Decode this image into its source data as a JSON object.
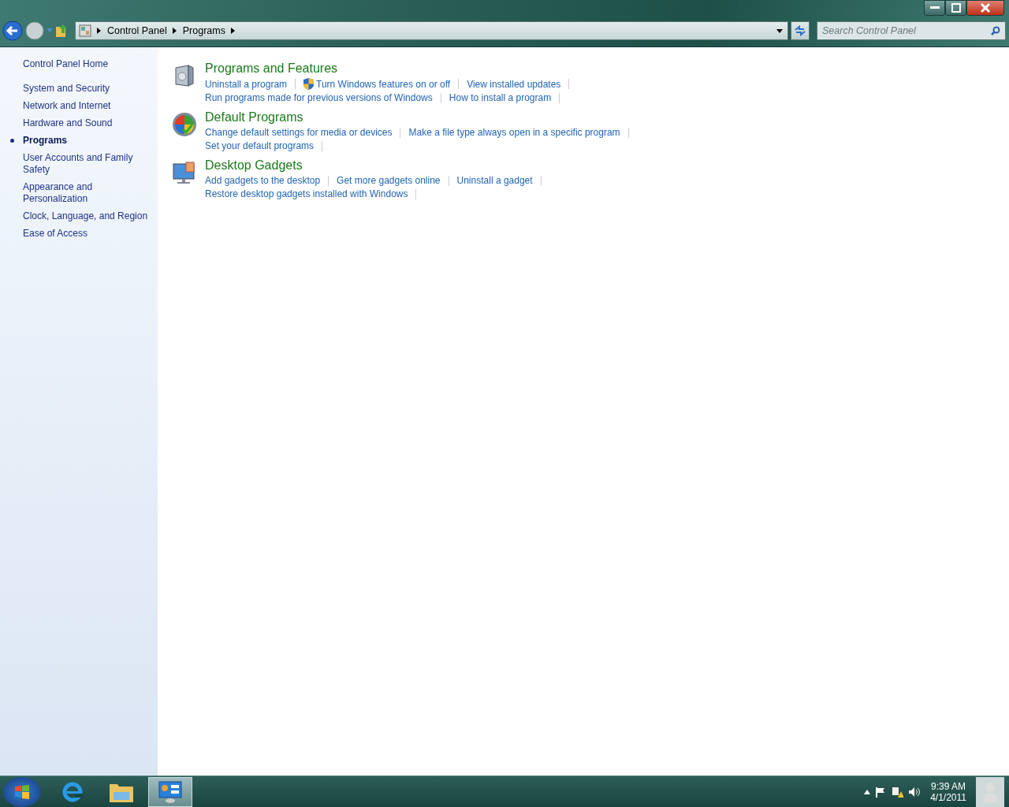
{
  "address_bar": {
    "breadcrumbs": [
      "Control Panel",
      "Programs"
    ]
  },
  "search": {
    "placeholder": "Search Control Panel"
  },
  "sidebar": {
    "home": "Control Panel Home",
    "items": [
      {
        "label": "System and Security",
        "selected": false
      },
      {
        "label": "Network and Internet",
        "selected": false
      },
      {
        "label": "Hardware and Sound",
        "selected": false
      },
      {
        "label": "Programs",
        "selected": true
      },
      {
        "label": "User Accounts and Family Safety",
        "selected": false
      },
      {
        "label": "Appearance and Personalization",
        "selected": false
      },
      {
        "label": "Clock, Language, and Region",
        "selected": false
      },
      {
        "label": "Ease of Access",
        "selected": false
      }
    ]
  },
  "sections": [
    {
      "kind": "programs",
      "title": "Programs and Features",
      "lines": [
        {
          "links": [
            {
              "label": "Uninstall a program",
              "shield": false
            },
            {
              "label": "Turn Windows features on or off",
              "shield": true
            },
            {
              "label": "View installed updates",
              "shield": false
            }
          ]
        },
        {
          "links": [
            {
              "label": "Run programs made for previous versions of Windows",
              "shield": false
            },
            {
              "label": "How to install a program",
              "shield": false
            }
          ]
        }
      ]
    },
    {
      "kind": "default",
      "title": "Default Programs",
      "lines": [
        {
          "links": [
            {
              "label": "Change default settings for media or devices",
              "shield": false
            },
            {
              "label": "Make a file type always open in a specific program",
              "shield": false
            }
          ]
        },
        {
          "links": [
            {
              "label": "Set your default programs",
              "shield": false
            }
          ]
        }
      ]
    },
    {
      "kind": "gadgets",
      "title": "Desktop Gadgets",
      "lines": [
        {
          "links": [
            {
              "label": "Add gadgets to the desktop",
              "shield": false
            },
            {
              "label": "Get more gadgets online",
              "shield": false
            },
            {
              "label": "Uninstall a gadget",
              "shield": false
            }
          ]
        },
        {
          "links": [
            {
              "label": "Restore desktop gadgets installed with Windows",
              "shield": false
            }
          ]
        }
      ]
    }
  ],
  "taskbar": {
    "apps": [
      {
        "kind": "browser",
        "active": false
      },
      {
        "kind": "folder",
        "active": false
      },
      {
        "kind": "control-panel",
        "active": true
      }
    ],
    "clock": {
      "time": "9:39 AM",
      "date": "4/1/2011"
    }
  }
}
